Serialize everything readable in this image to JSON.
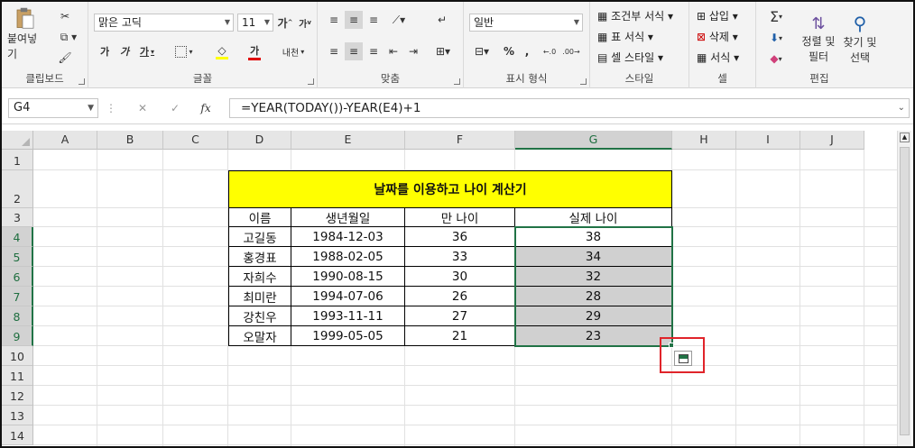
{
  "ribbon": {
    "clipboard": {
      "paste_label": "붙여넣기",
      "group_label": "클립보드"
    },
    "font": {
      "name": "맑은 고딕",
      "size": "11",
      "group_label": "글꼴",
      "bold": "가",
      "italic": "가",
      "underline": "가",
      "grow": "가",
      "shrink": "가",
      "color_char": "가",
      "phonetic": "내천"
    },
    "align": {
      "group_label": "맞춤"
    },
    "number": {
      "format": "일반",
      "group_label": "표시 형식"
    },
    "styles": {
      "cond": "조건부 서식",
      "table": "표 서식",
      "cell": "셀 스타일",
      "group_label": "스타일"
    },
    "cells": {
      "insert": "삽입",
      "delete": "삭제",
      "format": "서식",
      "group_label": "셀"
    },
    "editing": {
      "sort1": "정렬 및",
      "sort2": "필터",
      "find1": "찾기 및",
      "find2": "선택",
      "group_label": "편집"
    }
  },
  "formula_bar": {
    "name_box": "G4",
    "fx": "fx",
    "formula": "=YEAR(TODAY())-YEAR(E4)+1"
  },
  "sheet": {
    "columns": [
      "A",
      "B",
      "C",
      "D",
      "E",
      "F",
      "G",
      "H",
      "I",
      "J"
    ],
    "rows": [
      "1",
      "2",
      "3",
      "4",
      "5",
      "6",
      "7",
      "8",
      "9",
      "10",
      "11",
      "12",
      "13",
      "14"
    ],
    "table_title": "날짜를 이용하고 나이 계산기",
    "headers": [
      "이름",
      "생년월일",
      "만 나이",
      "실제 나이"
    ],
    "data": [
      [
        "고길동",
        "1984-12-03",
        "36",
        "38"
      ],
      [
        "홍경표",
        "1988-02-05",
        "33",
        "34"
      ],
      [
        "자희수",
        "1990-08-15",
        "30",
        "32"
      ],
      [
        "최미란",
        "1994-07-06",
        "26",
        "28"
      ],
      [
        "강친우",
        "1993-11-11",
        "27",
        "29"
      ],
      [
        "오말자",
        "1999-05-05",
        "21",
        "23"
      ]
    ]
  },
  "colors": {
    "excel_green": "#217346",
    "highlight": "#ffff00",
    "selected_fill": "#d0d0d0",
    "annotation": "#e0242a"
  }
}
